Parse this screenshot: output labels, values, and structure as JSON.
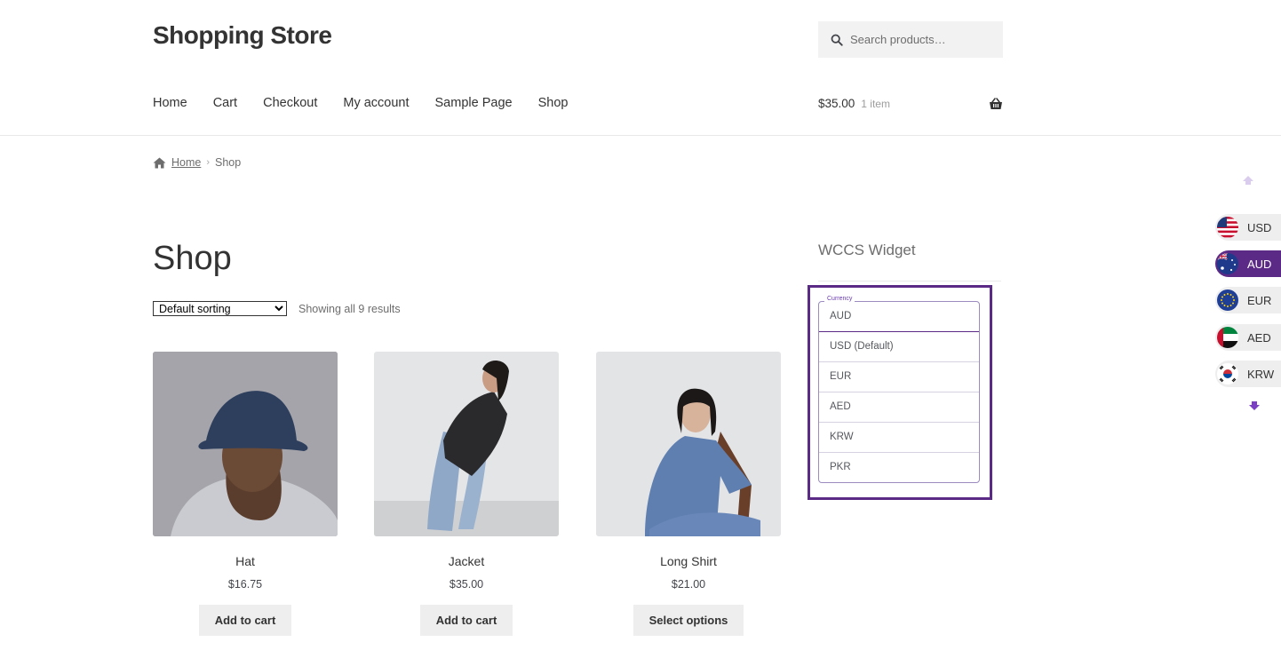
{
  "header": {
    "site_title": "Shopping Store",
    "search_placeholder": "Search products…",
    "nav": [
      "Home",
      "Cart",
      "Checkout",
      "My account",
      "Sample Page",
      "Shop"
    ],
    "cart_total": "$35.00",
    "cart_count": "1 item"
  },
  "breadcrumb": {
    "home": "Home",
    "current": "Shop"
  },
  "shop": {
    "title": "Shop",
    "sorting_selected": "Default sorting",
    "result_count": "Showing all 9 results",
    "products": [
      {
        "name": "Hat",
        "price": "$16.75",
        "button": "Add to cart"
      },
      {
        "name": "Jacket",
        "price": "$35.00",
        "button": "Add to cart"
      },
      {
        "name": "Long Shirt",
        "price": "$21.00",
        "button": "Select options"
      }
    ]
  },
  "widget": {
    "title": "WCCS Widget",
    "legend": "Currency",
    "options": [
      "AUD",
      "USD (Default)",
      "EUR",
      "AED",
      "KRW",
      "PKR"
    ],
    "selected": "AUD"
  },
  "switcher": {
    "currencies": [
      {
        "code": "USD",
        "flag": "us-flag-icon"
      },
      {
        "code": "AUD",
        "flag": "au-flag-icon"
      },
      {
        "code": "EUR",
        "flag": "eu-flag-icon"
      },
      {
        "code": "AED",
        "flag": "ae-flag-icon"
      },
      {
        "code": "KRW",
        "flag": "kr-flag-icon"
      }
    ],
    "active": "AUD"
  },
  "colors": {
    "accent": "#5b2a86",
    "button_bg": "#eeeeee",
    "text": "#333333"
  }
}
